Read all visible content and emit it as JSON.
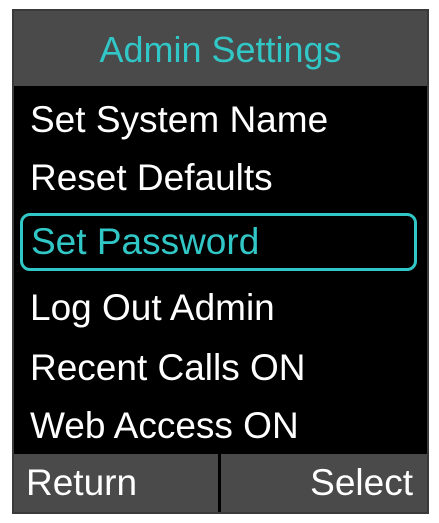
{
  "screen": {
    "title": "Admin Settings",
    "menu": [
      {
        "label": "Set System Name",
        "selected": false
      },
      {
        "label": "Reset Defaults",
        "selected": false
      },
      {
        "label": "Set Password",
        "selected": true
      },
      {
        "label": "Log Out Admin",
        "selected": false
      },
      {
        "label": "Recent Calls ON",
        "selected": false
      },
      {
        "label": "Web Access ON",
        "selected": false
      }
    ],
    "softkeys": {
      "left": "Return",
      "right": "Select"
    }
  },
  "colors": {
    "accent": "#32c7c7",
    "background": "#000000",
    "bar": "#4a4a4a",
    "text": "#ffffff"
  }
}
